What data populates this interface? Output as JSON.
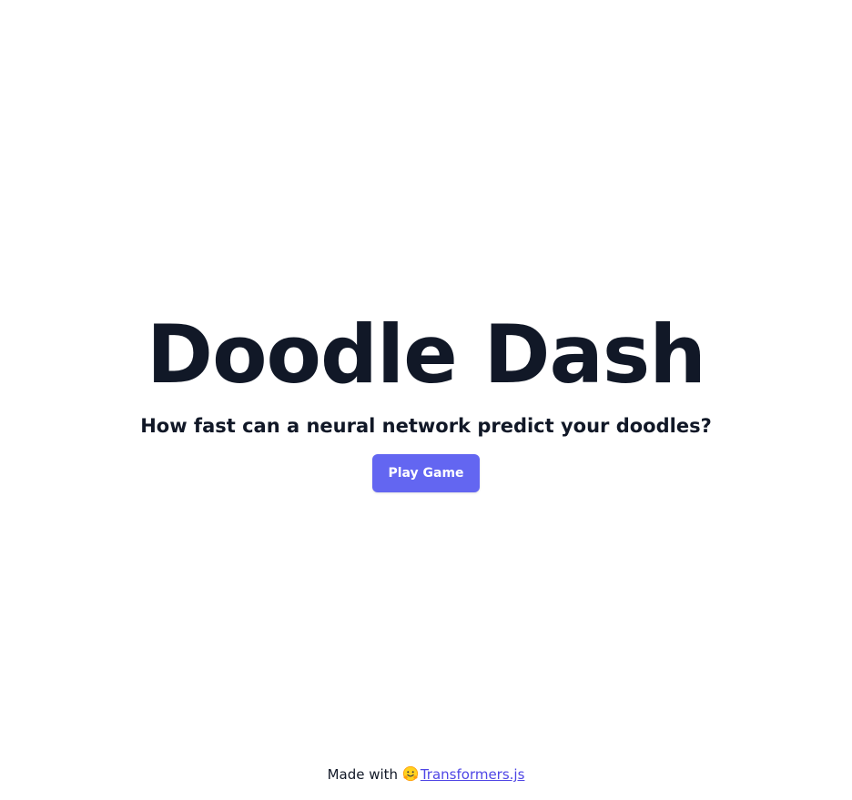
{
  "hero": {
    "title": "Doodle Dash",
    "subtitle": "How fast can a neural network predict your doodles?",
    "play_button_label": "Play Game"
  },
  "footer": {
    "made_with_text": "Made with",
    "link_icon": "hugging-face-icon",
    "link_text": "Transformers.js"
  },
  "colors": {
    "text": "#111827",
    "accent": "#6366f1",
    "link": "#4f46e5",
    "background": "#ffffff"
  }
}
